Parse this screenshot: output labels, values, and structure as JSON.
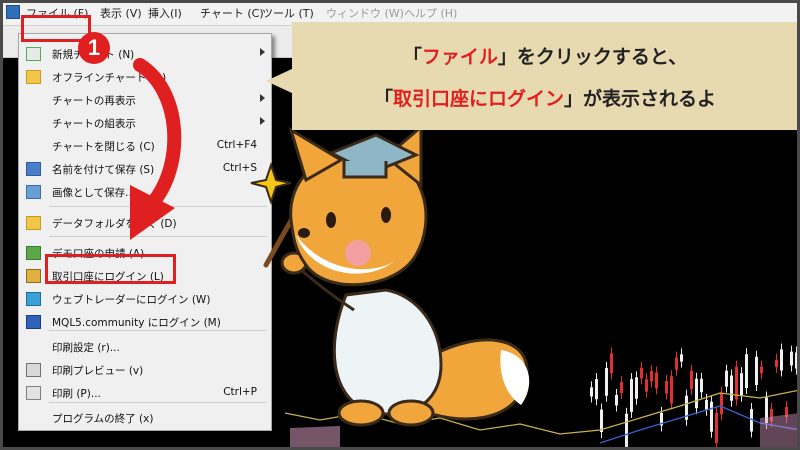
{
  "menubar": {
    "items": [
      {
        "label": "ファイル (F)",
        "disabled": false
      },
      {
        "label": "表示 (V)",
        "disabled": false
      },
      {
        "label": "挿入(I)",
        "disabled": false
      },
      {
        "label": "チャート (C)",
        "disabled": false
      },
      {
        "label": "ツール (T)",
        "disabled": false
      },
      {
        "label": "ウィンドウ (W)",
        "disabled": true
      },
      {
        "label": "ヘルプ (H)",
        "disabled": true
      }
    ]
  },
  "file_menu": {
    "items": [
      {
        "label": "新規チャート (N)",
        "shortcut": "",
        "submenu": true,
        "icon": "new-chart-icon"
      },
      {
        "label": "オフラインチャート (O)",
        "shortcut": "",
        "submenu": false,
        "icon": "folder-icon"
      },
      {
        "label": "チャートの再表示",
        "shortcut": "",
        "submenu": true,
        "icon": ""
      },
      {
        "label": "チャートの組表示",
        "shortcut": "",
        "submenu": true,
        "icon": ""
      },
      {
        "label": "チャートを閉じる (C)",
        "shortcut": "Ctrl+F4",
        "submenu": false,
        "icon": ""
      },
      {
        "label": "名前を付けて保存 (S)",
        "shortcut": "Ctrl+S",
        "submenu": false,
        "icon": "save-icon"
      },
      {
        "label": "画像として保存...",
        "shortcut": "",
        "submenu": false,
        "icon": "image-save-icon"
      },
      {
        "label": "データフォルダを開く (D)",
        "shortcut": "",
        "submenu": false,
        "icon": "folder-icon"
      },
      {
        "label": "デモ口座の申請 (A)",
        "shortcut": "",
        "submenu": false,
        "icon": "user-add-icon"
      },
      {
        "label": "取引口座にログイン (L)",
        "shortcut": "",
        "submenu": false,
        "icon": "user-key-icon"
      },
      {
        "label": "ウェブトレーダーにログイン (W)",
        "shortcut": "",
        "submenu": false,
        "icon": "web-icon"
      },
      {
        "label": "MQL5.community にログイン (M)",
        "shortcut": "",
        "submenu": false,
        "icon": "mql5-icon"
      },
      {
        "label": "印刷設定 (r)...",
        "shortcut": "",
        "submenu": false,
        "icon": ""
      },
      {
        "label": "印刷プレビュー (v)",
        "shortcut": "",
        "submenu": false,
        "icon": "print-preview-icon"
      },
      {
        "label": "印刷 (P)...",
        "shortcut": "Ctrl+P",
        "submenu": false,
        "icon": "print-icon"
      },
      {
        "label": "プログラムの終了 (x)",
        "shortcut": "",
        "submenu": false,
        "icon": ""
      }
    ]
  },
  "step_badge": "1",
  "callout": {
    "line1": {
      "pre": "「",
      "red": "ファイル",
      "post": "」をクリックすると、"
    },
    "line2": {
      "pre": "「",
      "red": "取引口座にログイン",
      "post": "」が表示されるよ"
    }
  },
  "colors": {
    "accent_red": "#e02020",
    "callout_bg": "#e8dab0",
    "fox_orange": "#f0a63a",
    "sparkle": "#f5c518"
  }
}
